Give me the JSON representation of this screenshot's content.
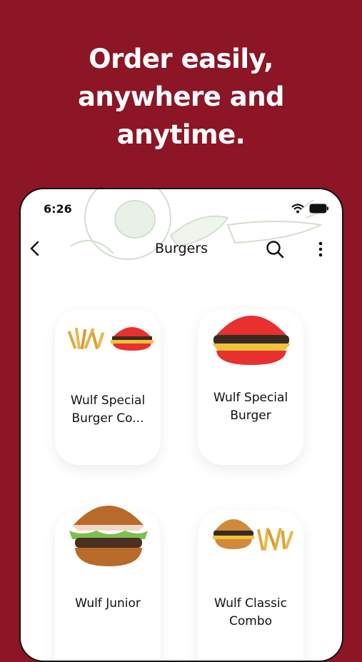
{
  "promo": {
    "lines": [
      "Order easily,",
      "anywhere and",
      "anytime."
    ]
  },
  "status": {
    "time": "6:26"
  },
  "nav": {
    "title": "Burgers"
  },
  "products": [
    {
      "name_line1": "Wulf Special",
      "name_line2": "Burger Co..."
    },
    {
      "name_line1": "Wulf Special",
      "name_line2": "Burger"
    },
    {
      "name_line1": "Wulf Junior",
      "name_line2": ""
    },
    {
      "name_line1": "Wulf Classic",
      "name_line2": "Combo"
    }
  ],
  "colors": {
    "background": "#8c1526",
    "bun_red": "#e8302f",
    "bun_brown": "#b86a2a",
    "cheese": "#f2c33a"
  }
}
